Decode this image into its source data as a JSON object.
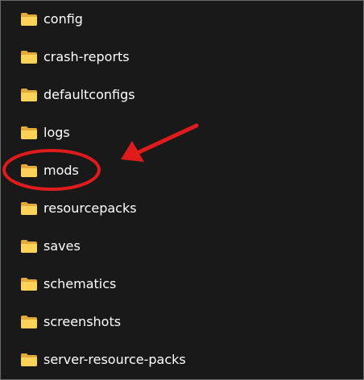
{
  "folders": [
    {
      "name": "config",
      "icon": "folder-icon"
    },
    {
      "name": "crash-reports",
      "icon": "folder-icon"
    },
    {
      "name": "defaultconfigs",
      "icon": "folder-icon"
    },
    {
      "name": "logs",
      "icon": "folder-icon"
    },
    {
      "name": "mods",
      "icon": "folder-icon"
    },
    {
      "name": "resourcepacks",
      "icon": "folder-icon"
    },
    {
      "name": "saves",
      "icon": "folder-icon"
    },
    {
      "name": "schematics",
      "icon": "folder-icon"
    },
    {
      "name": "screenshots",
      "icon": "folder-icon"
    },
    {
      "name": "server-resource-packs",
      "icon": "folder-icon"
    }
  ],
  "colors": {
    "background": "#191919",
    "text": "#ffffff",
    "folder_back": "#e2a93b",
    "folder_front": "#ffd25a",
    "annotation": "#e01b1b",
    "border": "#6b6b6b"
  }
}
